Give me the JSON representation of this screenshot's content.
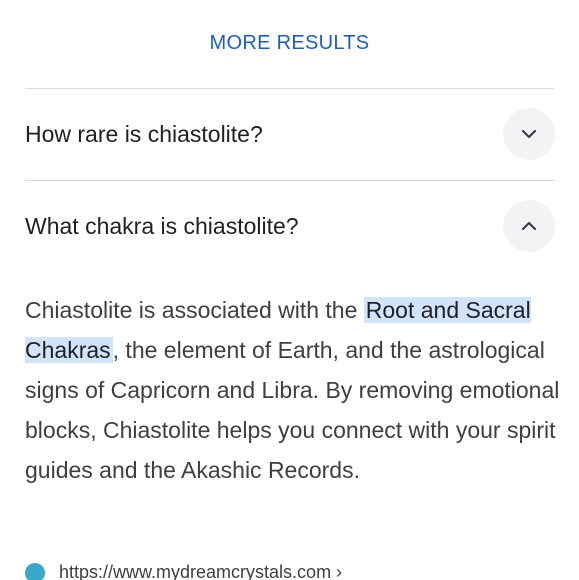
{
  "more_results": {
    "label": "MORE RESULTS"
  },
  "faq": {
    "items": [
      {
        "question": "How rare is chiastolite?",
        "expanded": false,
        "toggle_icon": "chevron-down-icon"
      },
      {
        "question": "What chakra is chiastolite?",
        "expanded": true,
        "toggle_icon": "chevron-up-icon"
      }
    ]
  },
  "answer": {
    "text_before": "Chiastolite is associated with the ",
    "highlight": "Root and Sacral Chakras",
    "text_after": ", the element of Earth, and the astrological signs of Capricorn and Libra. By removing emotional blocks, Chiastolite helps you connect with your spirit guides and the Akashic Records."
  },
  "source": {
    "url": "https://www.mydreamcrystals.com ›",
    "favicon_color": "#3aa6c9"
  },
  "colors": {
    "link": "#1a5fc8",
    "highlight_bg": "#d2e3fc",
    "button_bg": "#f1f3f4",
    "divider": "#d7d9dc"
  }
}
